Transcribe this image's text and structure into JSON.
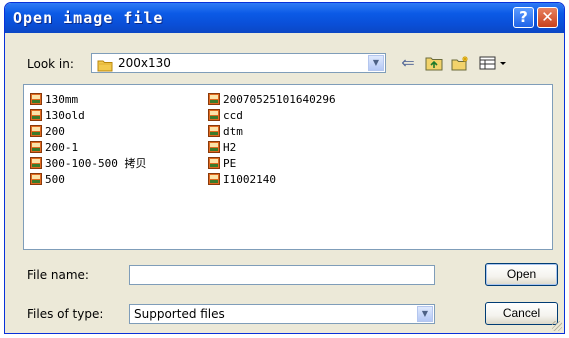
{
  "window": {
    "title": "Open image file",
    "help_glyph": "?",
    "close_glyph": "✕"
  },
  "look_in": {
    "label": "Look in:",
    "value": "200x130",
    "arrow_glyph": "▼"
  },
  "toolbar": {
    "back_glyph": "⇐",
    "up_folder_glyph": "⬑",
    "new_folder_glyph": "✳",
    "view_menu_glyph": "▦▾"
  },
  "files": {
    "column1": [
      "130mm",
      "130old",
      "200",
      "200-1",
      "300-100-500 拷贝",
      "500"
    ],
    "column2": [
      "20070525101640296",
      "ccd",
      "dtm",
      "H2",
      "PE",
      "I1002140"
    ]
  },
  "file_name": {
    "label": "File name:",
    "value": ""
  },
  "file_type": {
    "label": "Files of type:",
    "value": "Supported files",
    "arrow_glyph": "▼"
  },
  "buttons": {
    "open": "Open",
    "cancel": "Cancel"
  },
  "colors": {
    "titlebar": "#0b5ae6",
    "dialog_bg": "#ece9d8",
    "file_icon": "#c8641e",
    "folder_icon": "#f2c94c"
  }
}
